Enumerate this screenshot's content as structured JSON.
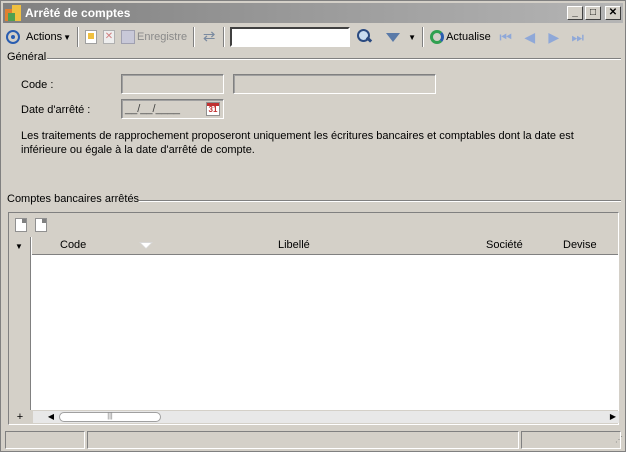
{
  "window": {
    "title": "Arrêté de comptes"
  },
  "title_buttons": {
    "minimize": "_",
    "maximize": "□",
    "close": "✕"
  },
  "toolbar": {
    "actions_label": "Actions",
    "save_label": "Enregistre",
    "search_value": "",
    "refresh_label": "Actualise"
  },
  "general": {
    "section_label": "Général",
    "code_label": "Code :",
    "code_value": "",
    "code_desc_value": "",
    "date_label": "Date d'arrêté :",
    "date_value": "__/__/____",
    "calendar_day": "31",
    "info_text": "Les traitements de rapprochement proposeront uniquement les écritures bancaires et comptables dont la date est inférieure ou égale à la date d'arrêté de compte."
  },
  "accounts": {
    "section_label": "Comptes bancaires arrêtés",
    "columns": [
      "Code",
      "Libellé",
      "Société",
      "Devise"
    ],
    "rows": [],
    "add_label": "+"
  },
  "icons": [
    "actions-icon",
    "new-icon",
    "delete-icon",
    "save-icon",
    "sync-icon",
    "search-icon",
    "filter-icon",
    "refresh-icon",
    "first-icon",
    "prev-icon",
    "next-icon",
    "last-icon",
    "calendar-icon"
  ]
}
